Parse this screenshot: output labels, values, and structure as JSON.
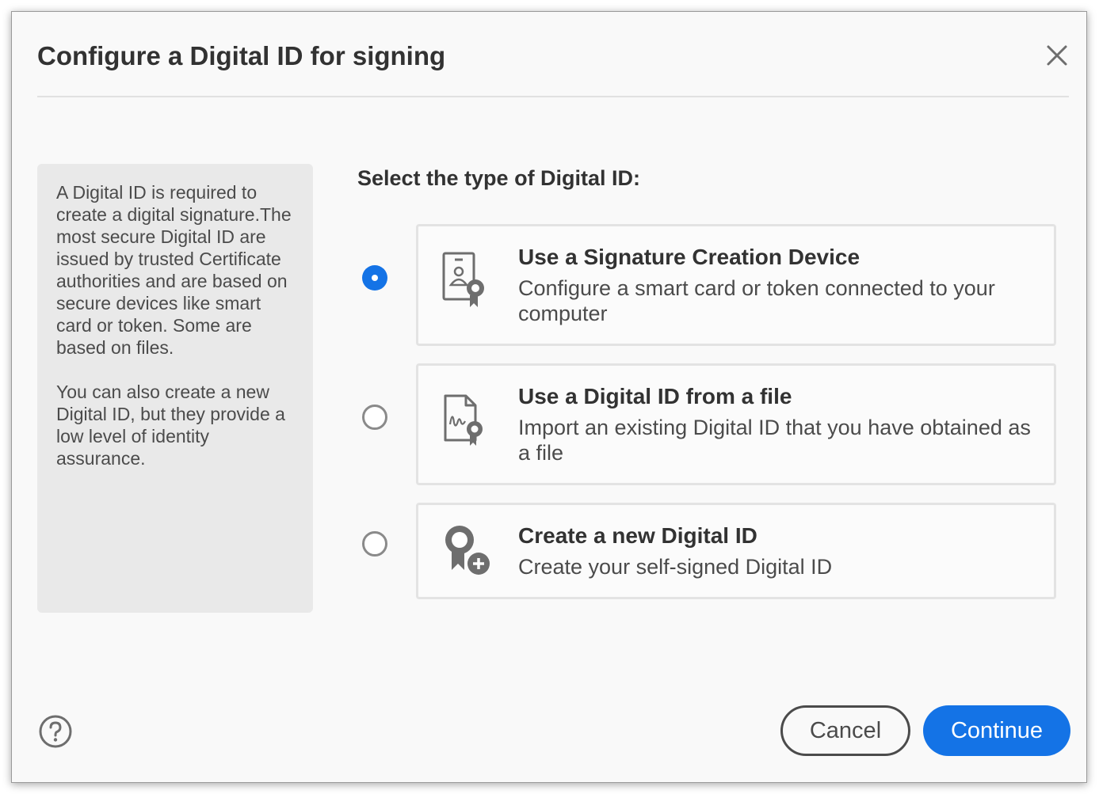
{
  "dialog": {
    "title": "Configure a Digital ID for signing",
    "close_icon": "close-icon"
  },
  "info": {
    "paragraph1": "A Digital ID is required to create a digital signature.The most secure Digital ID are issued by trusted Certificate authorities and are based on secure devices like smart card or token. Some are based on files.",
    "paragraph2": "You can also create a new Digital ID, but they provide a low level of identity assurance."
  },
  "selection": {
    "heading": "Select the type of Digital ID:",
    "options": [
      {
        "title": "Use a Signature Creation Device",
        "description": "Configure a smart card or token connected to your computer",
        "icon": "signature-device-icon",
        "selected": true
      },
      {
        "title": "Use a Digital ID from a file",
        "description": "Import an existing Digital ID that you have obtained as a file",
        "icon": "digital-id-file-icon",
        "selected": false
      },
      {
        "title": "Create a new Digital ID",
        "description": "Create your self-signed Digital ID",
        "icon": "new-digital-id-icon",
        "selected": false
      }
    ]
  },
  "footer": {
    "help_icon": "help-icon",
    "cancel_label": "Cancel",
    "continue_label": "Continue"
  },
  "colors": {
    "accent": "#1473e6",
    "panel_background": "#e9e9e9",
    "text_primary": "#323232",
    "text_secondary": "#4b4b4b"
  }
}
